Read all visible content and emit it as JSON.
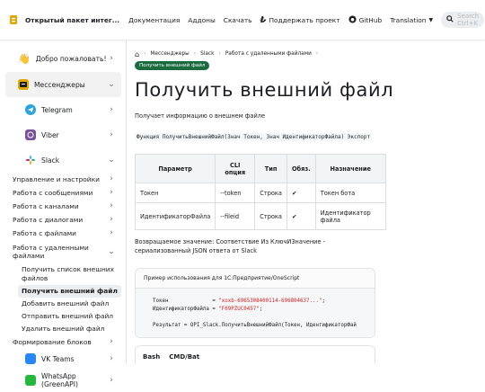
{
  "navbar": {
    "title": "Открытый пакет интег...",
    "links": [
      "Документация",
      "Аддоны",
      "Скачать"
    ],
    "support": "Поддержать проект",
    "github": "GitHub",
    "translation": "Translation",
    "search_placeholder": "Search Ctrl+K"
  },
  "sidebar": {
    "welcome": "Добро пожаловать!",
    "messengers": "Мессенджеры",
    "telegram": "Telegram",
    "viber": "Viber",
    "slack": "Slack",
    "slack_items": [
      "Управление и настройки",
      "Работа с сообщениями",
      "Работа с каналами",
      "Работа с диалогами",
      "Работа с файлами"
    ],
    "remote_files": "Работа с удаленными файлами",
    "remote_items": [
      "Получить список внешних файлов",
      "Получить внешний файл",
      "Добавить внешний файл",
      "Отправить внешний файл",
      "Удалить внешний файл"
    ],
    "blocks": "Формирование блоков",
    "vkteams": "VK Teams",
    "whatsapp": "WhatsApp (GreenAPI)"
  },
  "breadcrumb": {
    "items": [
      "Мессенджеры",
      "Slack",
      "Работа с удаленными файлами"
    ],
    "current": "Получить внешний файл"
  },
  "page": {
    "title": "Получить внешний файл",
    "intro": "Получает информацию о внешнем файле",
    "signature": "Функция ПолучитьВнешнийФайл(Знач Токен, Знач ИдентификаторФайла) Экспорт",
    "table_headers": [
      "Параметр",
      "CLI опция",
      "Тип",
      "Обяз.",
      "Назначение"
    ],
    "table_rows": [
      [
        "Токен",
        "--token",
        "Строка",
        "✔",
        "Токен бота"
      ],
      [
        "ИдентификаторФайла",
        "--fileid",
        "Строка",
        "✔",
        "Идентификатор файла"
      ]
    ],
    "return_text": "Возвращаемое значение: Соответствие Из КлючИЗначение - сериализованный JSON ответа от Slack",
    "example_title": "Пример использования для 1С:Предприятие/OneScript",
    "code_line1_name": "Токен",
    "code_line1_value": "\"xoxb-6965308400114-696804637...\"",
    "code_line2_name": "ИдентификаторФайла",
    "code_line2_value": "\"F09PZUC0457\"",
    "code_line3": "Результат = OPI_Slack.ПолучитьВнешнийФайл(Токен, ИдентификаторФай",
    "tab_bash": "Bash",
    "tab_cmd": "CMD/Bat"
  },
  "colors": {
    "accent": "#1a6b3d",
    "string": "#d12020"
  }
}
